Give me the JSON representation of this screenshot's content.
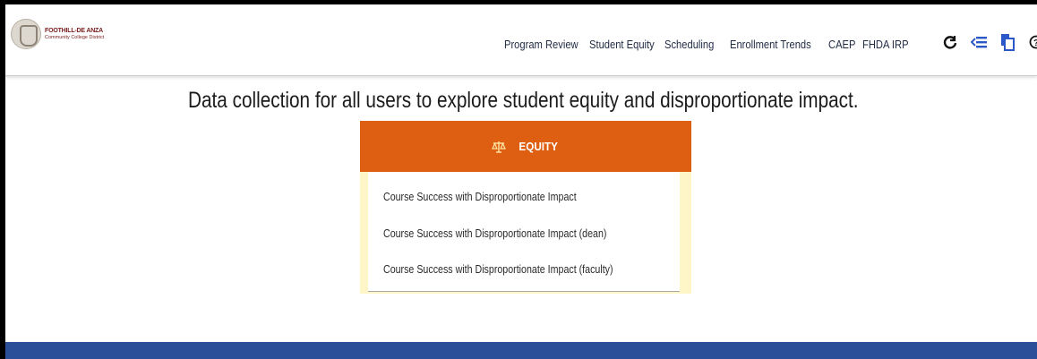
{
  "logo": {
    "line1": "FOOTHILL-DE ANZA",
    "line2": "Community College District"
  },
  "nav": {
    "items": [
      "Program Review",
      "Student Equity",
      "Scheduling",
      "Enrollment Trends",
      "CAEP",
      "FHDA IRP"
    ]
  },
  "icons": [
    "refresh-icon",
    "menu-toggle-icon",
    "file-copy-icon",
    "help-icon"
  ],
  "headline": "Data collection for all users to explore student equity and disproportionate impact.",
  "card": {
    "title": "EQUITY",
    "icon": "scale-icon",
    "links": [
      "Course Success with Disproportionate Impact",
      "Course Success with Disproportionate Impact (dean)",
      "Course Success with Disproportionate Impact (faculty)"
    ]
  },
  "colors": {
    "accent": "#df5f12",
    "card_background": "#fff6c7",
    "footer": "#2b4f99"
  }
}
